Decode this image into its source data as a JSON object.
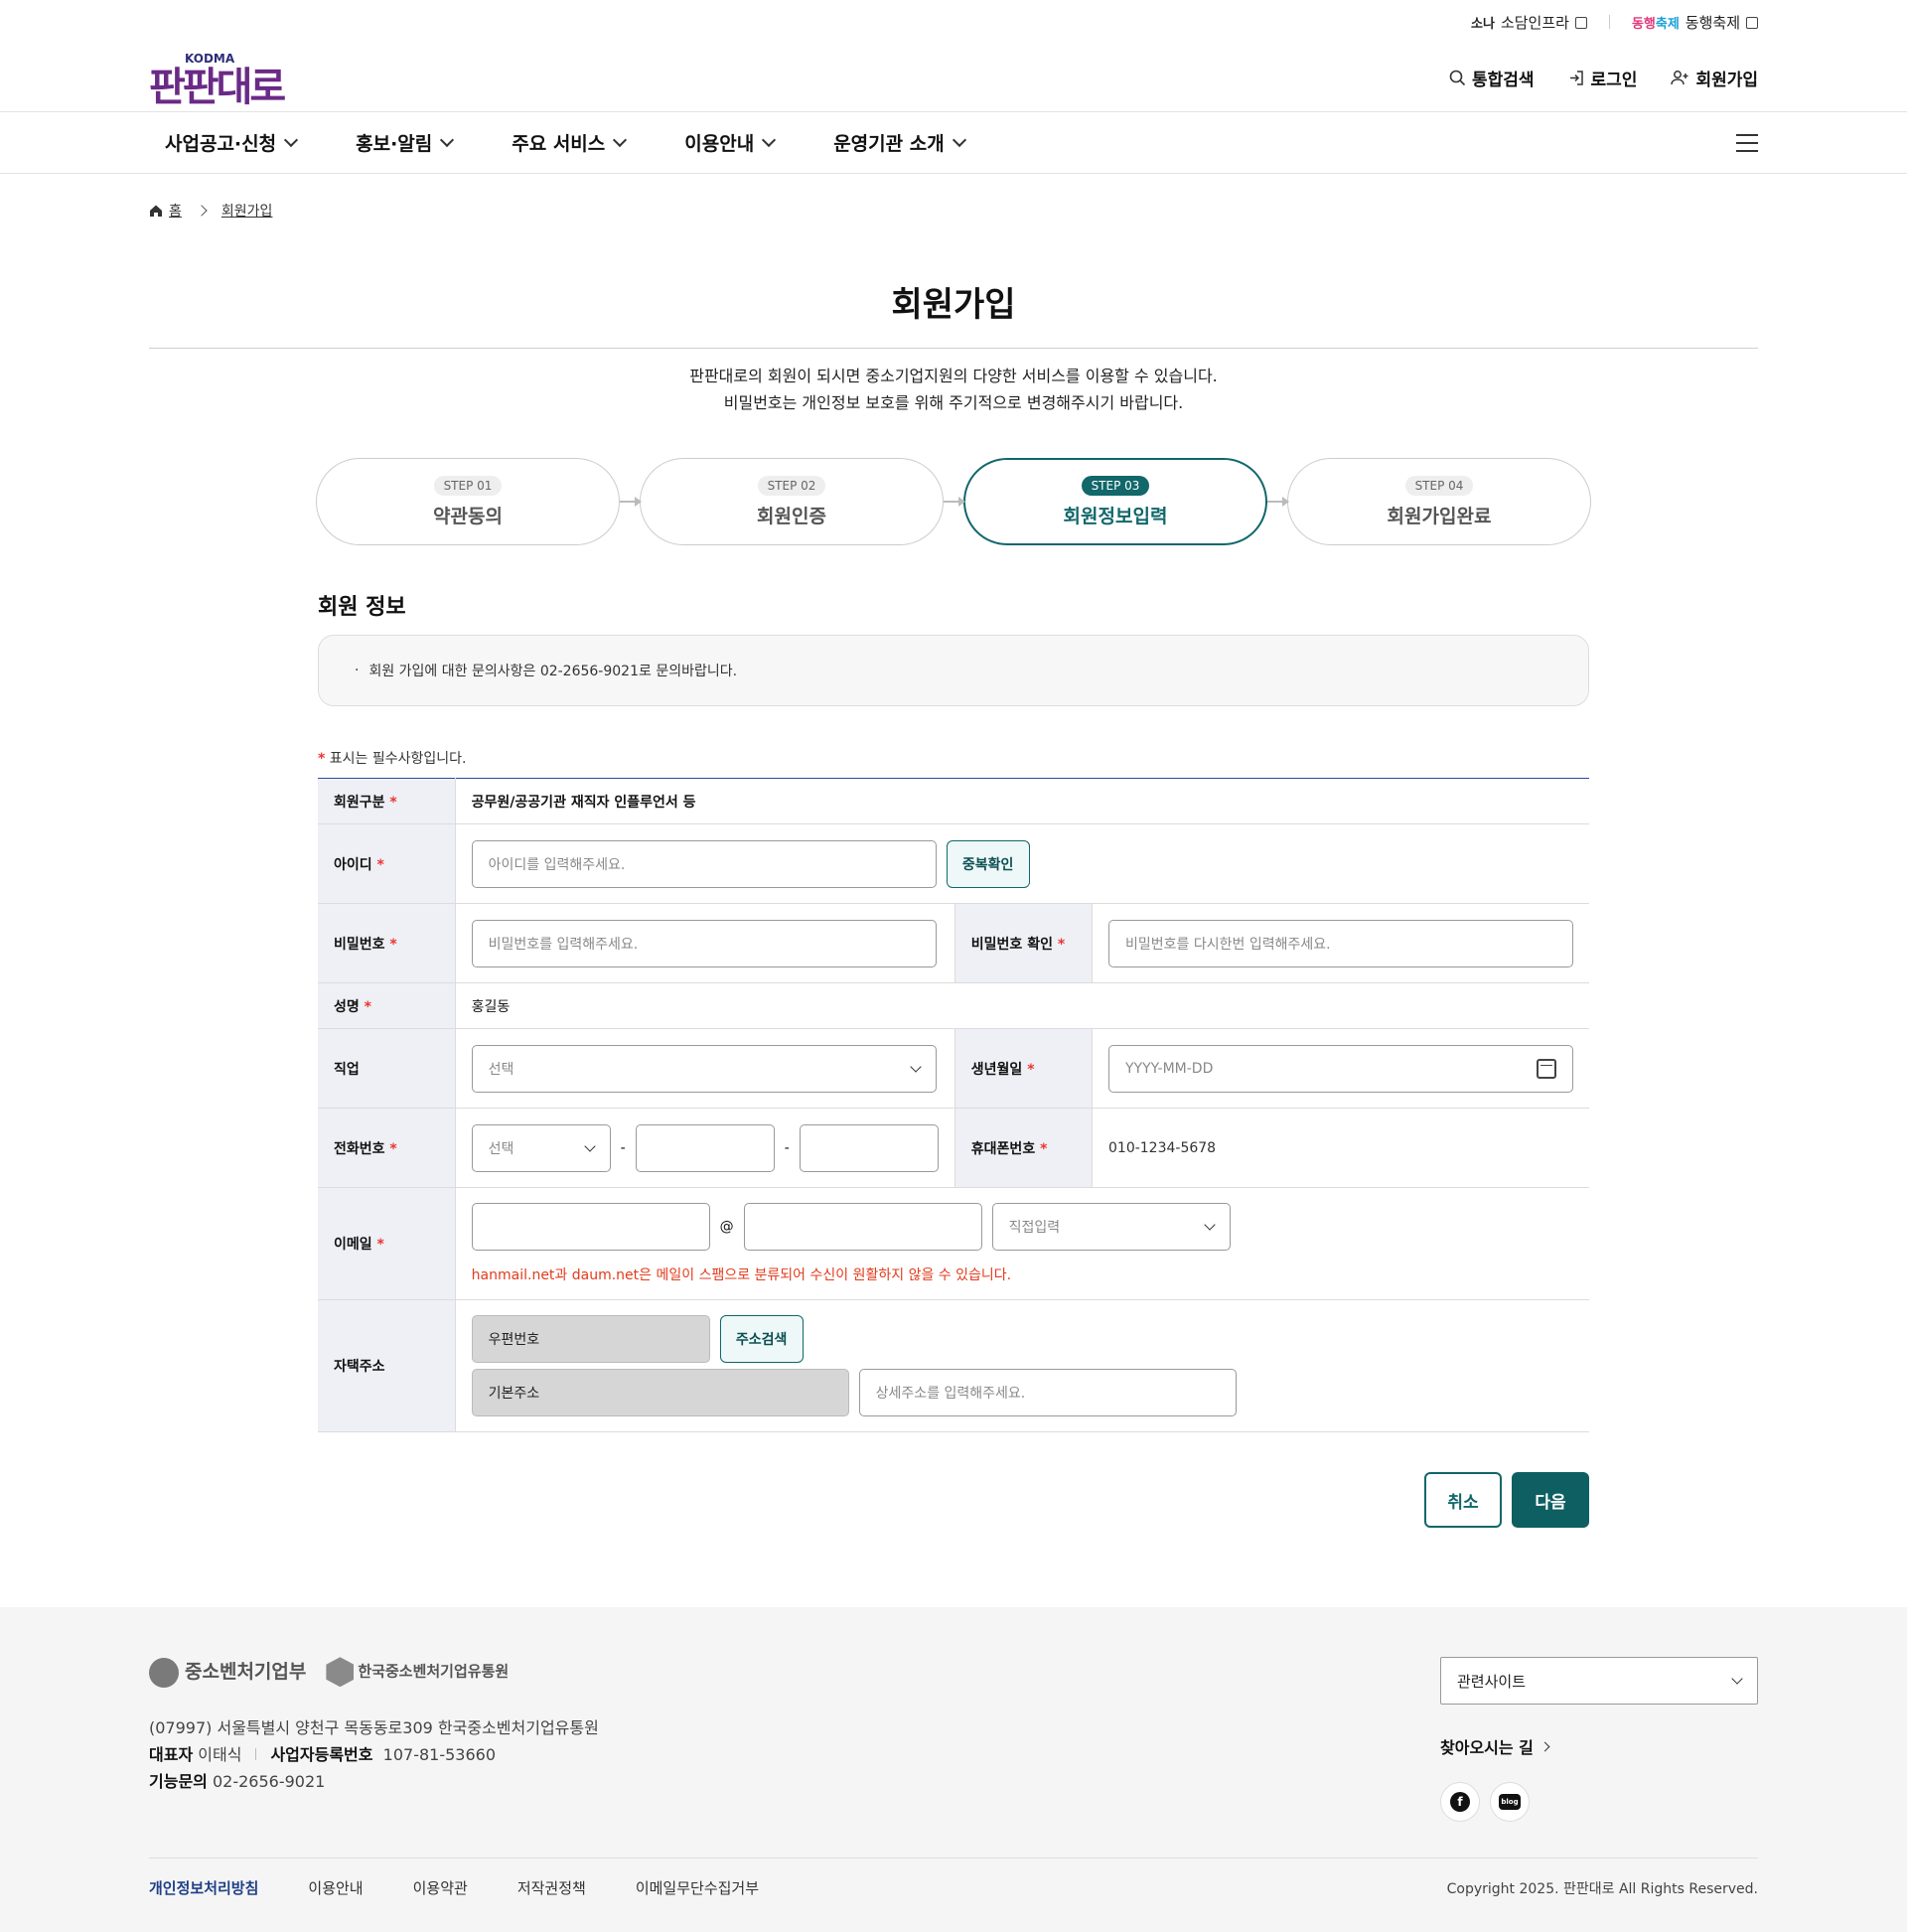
{
  "util": {
    "link1_logo": "소나",
    "link1": "소담인프라",
    "link2_logo_a": "동행",
    "link2_logo_b": "축제",
    "link2": "동행축제"
  },
  "brand": {
    "name": "판판대로",
    "sub": "KODMA"
  },
  "header_links": {
    "search": "통합검색",
    "login": "로그인",
    "join": "회원가입"
  },
  "gnb": [
    "사업공고·신청",
    "홍보·알림",
    "주요 서비스",
    "이용안내",
    "운영기관 소개"
  ],
  "breadcrumb": {
    "home": "홈",
    "current": "회원가입"
  },
  "page": {
    "title": "회원가입",
    "desc1": "판판대로의 회원이 되시면 중소기업지원의 다양한 서비스를 이용할 수 있습니다.",
    "desc2": "비밀번호는 개인정보 보호를 위해 주기적으로 변경해주시기 바랍니다."
  },
  "steps": [
    {
      "num": "STEP 01",
      "label": "약관동의"
    },
    {
      "num": "STEP 02",
      "label": "회원인증"
    },
    {
      "num": "STEP 03",
      "label": "회원정보입력"
    },
    {
      "num": "STEP 04",
      "label": "회원가입완료"
    }
  ],
  "section": {
    "title": "회원 정보",
    "notice": "회원 가입에 대한 문의사항은 02-2656-9021로 문의바랍니다.",
    "req_star": "*",
    "req_note": " 표시는 필수사항입니다."
  },
  "form": {
    "member_type": {
      "label": "회원구분",
      "value": "공무원/공공기관 재직자 인플루언서 등"
    },
    "id": {
      "label": "아이디",
      "placeholder": "아이디를 입력해주세요.",
      "button": "중복확인"
    },
    "pw": {
      "label": "비밀번호",
      "placeholder": "비밀번호를 입력해주세요."
    },
    "pw_confirm": {
      "label": "비밀번호 확인",
      "placeholder": "비밀번호를 다시한번 입력해주세요."
    },
    "name": {
      "label": "성명",
      "value": "홍길동"
    },
    "job": {
      "label": "직업",
      "value": "선택"
    },
    "birth": {
      "label": "생년월일",
      "placeholder": "YYYY-MM-DD"
    },
    "phone": {
      "label": "전화번호",
      "select": "선택",
      "dash": "-"
    },
    "mobile": {
      "label": "휴대폰번호",
      "value": "010-1234-5678"
    },
    "email": {
      "label": "이메일",
      "at": "@",
      "domain_select": "직접입력",
      "warning": "hanmail.net과 daum.net은 메일이 스팸으로 분류되어 수신이 원활하지 않을 수 있습니다."
    },
    "address": {
      "label": "자택주소",
      "zip": "우편번호",
      "button": "주소검색",
      "base": "기본주소",
      "detail_placeholder": "상세주소를 입력해주세요."
    }
  },
  "actions": {
    "cancel": "취소",
    "next": "다음"
  },
  "footer": {
    "logo1": "중소벤처기업부",
    "logo2": "한국중소벤처기업유통원",
    "address": "(07997) 서울특별시 양천구 목동동로309 한국중소벤처기업유통원",
    "ceo_label": "대표자",
    "ceo": "이태식",
    "biz_label": "사업자등록번호",
    "biz": "107-81-53660",
    "tel_label": "기능문의",
    "tel": "02-2656-9021",
    "related": "관련사이트",
    "directions": "찾아오시는 길",
    "sns_fb": "f",
    "sns_blog": "blog",
    "links": [
      "개인정보처리방침",
      "이용안내",
      "이용약관",
      "저작권정책",
      "이메일무단수집거부"
    ],
    "copyright": "Copyright 2025. 판판대로 All Rights Reserved."
  },
  "colors": {
    "primary": "#11676a",
    "brand": "#6a2a86",
    "warning": "#e33b1c",
    "required": "#e33333"
  }
}
